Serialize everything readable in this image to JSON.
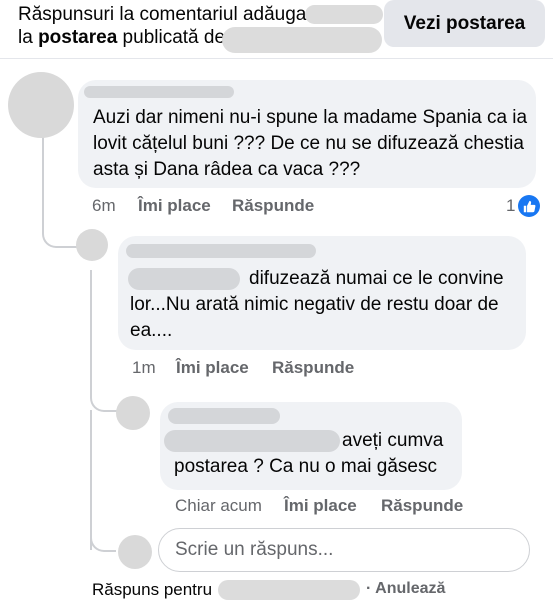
{
  "header": {
    "line1": "Răspunsuri la comentariul adăuga",
    "line2_prefix": "la ",
    "line2_bold": "postarea",
    "line2_suffix": " publicată de",
    "view_post_label": "Vezi postarea"
  },
  "comments": [
    {
      "text": "Auzi dar nimeni nu-i spune la madame Spania ca ia lovit cățelul buni ??? De ce nu se difuzează chestia asta și Dana râdea ca vaca ???",
      "time": "6m",
      "like_label": "Îmi place",
      "reply_label": "Răspunde",
      "reaction_count": "1"
    },
    {
      "text_part1": "difuzează numai ce le convine",
      "text_rest": "lor...Nu arată nimic negativ de restu doar de ea....",
      "time": "1m",
      "like_label": "Îmi place",
      "reply_label": "Răspunde"
    },
    {
      "text_part1": "aveți cumva",
      "text_rest": "postarea ? Ca nu o mai găsesc",
      "time": "Chiar acum",
      "like_label": "Îmi place",
      "reply_label": "Răspunde"
    }
  ],
  "reply_box": {
    "placeholder": "Scrie un răspuns...",
    "replying_to_label": "Răspuns pentru",
    "cancel_label": "· Anulează"
  },
  "colors": {
    "accent": "#1877f2",
    "bubble": "#f0f2f5",
    "meta_text": "#65676b"
  }
}
